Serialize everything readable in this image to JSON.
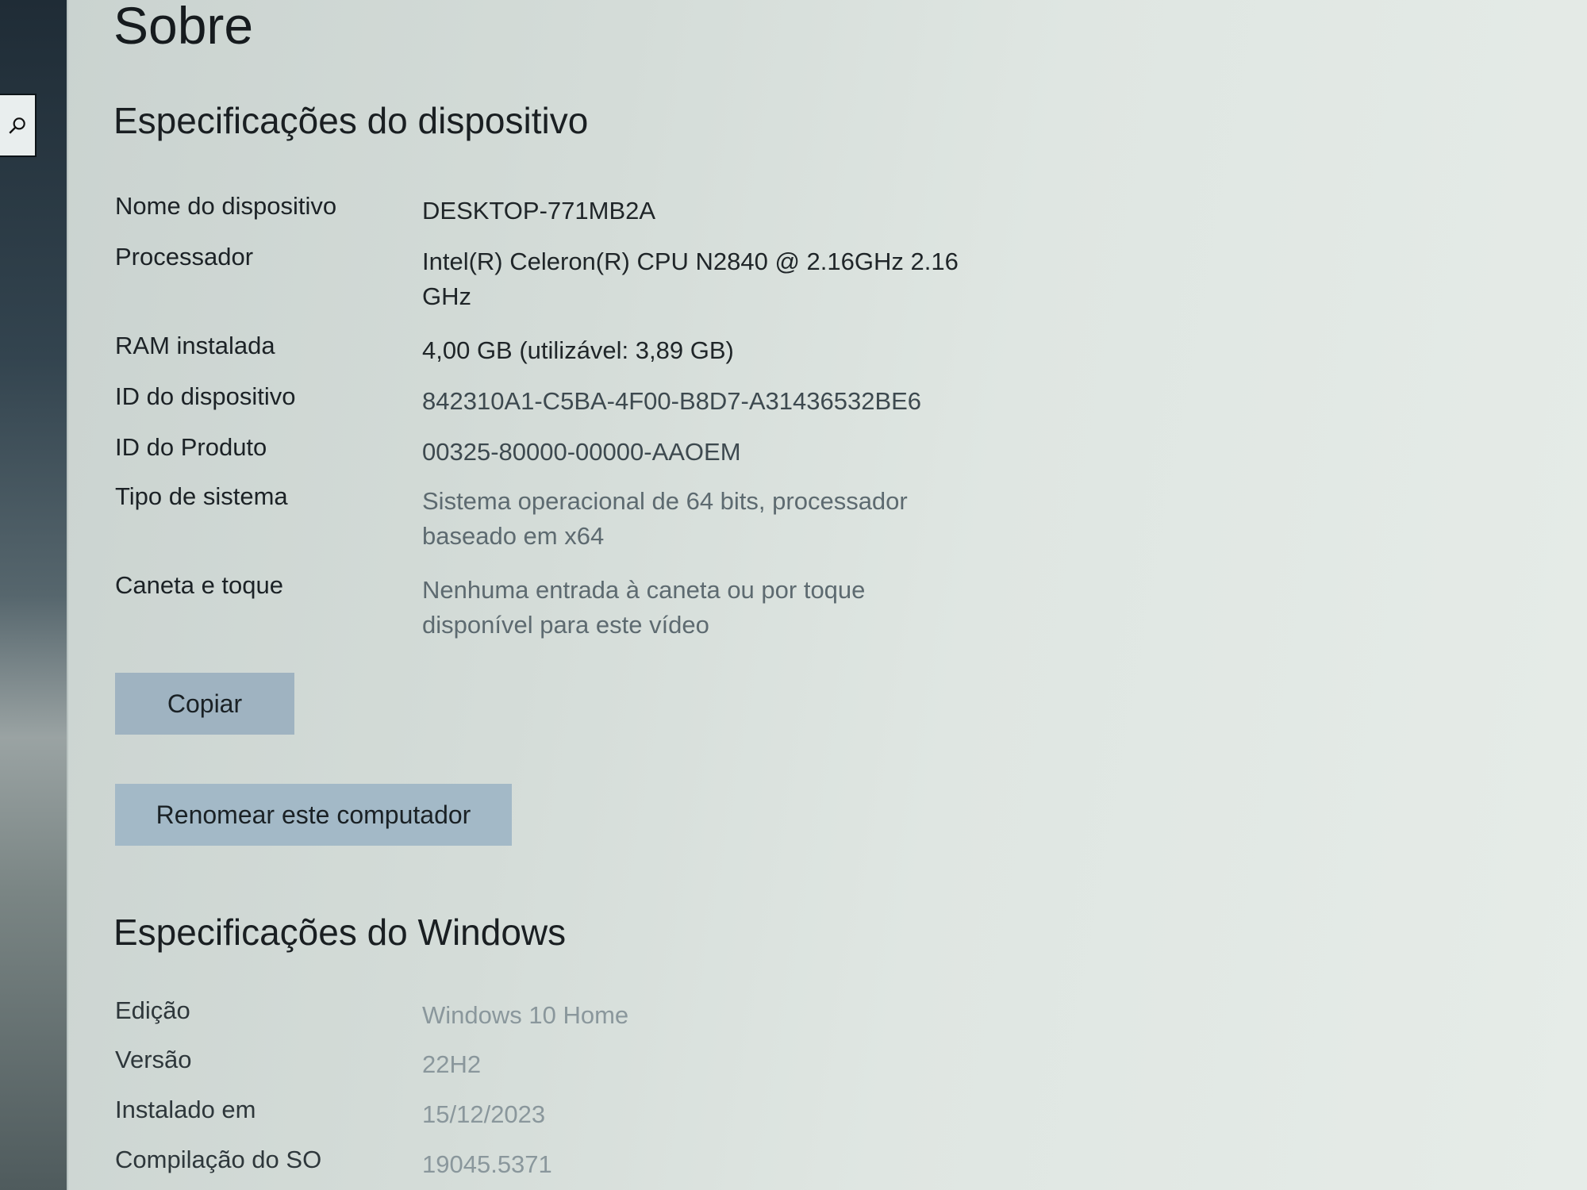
{
  "sidebar": {
    "search_icon": "search-icon"
  },
  "page": {
    "title": "Sobre"
  },
  "device_specs": {
    "heading": "Especificações do dispositivo",
    "rows": [
      {
        "label": "Nome do dispositivo",
        "value": "DESKTOP-771MB2A"
      },
      {
        "label": "Processador",
        "value": "Intel(R) Celeron(R) CPU  N2840  @ 2.16GHz 2.16 GHz"
      },
      {
        "label": "RAM instalada",
        "value": "4,00 GB (utilizável: 3,89 GB)"
      },
      {
        "label": "ID do dispositivo",
        "value": "842310A1-C5BA-4F00-B8D7-A31436532BE6"
      },
      {
        "label": "ID do Produto",
        "value": "00325-80000-00000-AAOEM"
      },
      {
        "label": "Tipo de sistema",
        "value": "Sistema operacional de 64 bits, processador baseado em x64"
      },
      {
        "label": "Caneta e toque",
        "value": "Nenhuma entrada à caneta ou por toque disponível para este vídeo"
      }
    ],
    "copy_button": "Copiar",
    "rename_button": "Renomear este computador"
  },
  "windows_specs": {
    "heading": "Especificações do Windows",
    "rows": [
      {
        "label": "Edição",
        "value": "Windows 10 Home"
      },
      {
        "label": "Versão",
        "value": "22H2"
      },
      {
        "label": "Instalado em",
        "value": "15/12/2023"
      },
      {
        "label": "Compilação do SO",
        "value": "19045.5371"
      }
    ]
  }
}
